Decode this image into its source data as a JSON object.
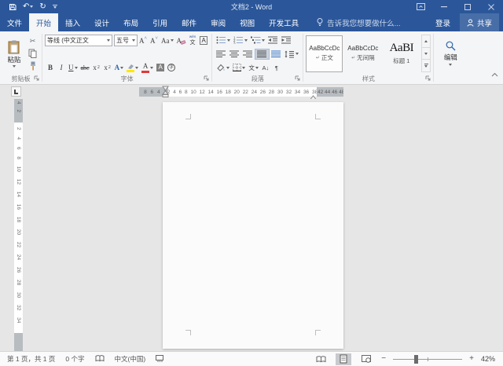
{
  "window": {
    "title": "文档2 - Word"
  },
  "tabs": {
    "file": "文件",
    "home": "开始",
    "insert": "插入",
    "design": "设计",
    "layout": "布局",
    "references": "引用",
    "mailings": "邮件",
    "review": "审阅",
    "view": "视图",
    "developer": "开发工具"
  },
  "tellme": "告诉我您想要做什么...",
  "account": {
    "sign_in": "登录",
    "share": "共享"
  },
  "glyphs": {
    "scissors": "✂",
    "undo": "↶",
    "redo": "↻",
    "sort": "A↓",
    "show_marks": "¶",
    "asian_layout": "文"
  },
  "ribbon": {
    "clipboard": {
      "label": "剪贴板",
      "paste": "粘贴"
    },
    "font": {
      "label": "字体",
      "font_name": "等线 (中文正文",
      "font_size": "五号",
      "grow_font": "A",
      "shrink_font": "A",
      "change_case": "Aa",
      "clear_format": "A",
      "phonetic_top": "wén",
      "phonetic_bottom": "文",
      "char_border": "A",
      "bold": "B",
      "italic": "I",
      "underline": "U",
      "strikethrough": "abc",
      "sub_base": "x",
      "sub_small": "2",
      "sup_base": "x",
      "sup_small": "2",
      "text_effects": "A",
      "font_color": "A",
      "char_shading": "A",
      "enclose": "字"
    },
    "paragraph": {
      "label": "段落"
    },
    "styles": {
      "label": "样式",
      "items": [
        {
          "preview": "AaBbCcDc",
          "mark": "↵",
          "name": "正文"
        },
        {
          "preview": "AaBbCcDc",
          "mark": "↵",
          "name": "无间隔"
        },
        {
          "preview": "AaBI",
          "mark": "",
          "name": "标题 1"
        }
      ]
    },
    "editing": {
      "label": "编辑"
    }
  },
  "ruler": {
    "h_left": "8 6 4 2",
    "h_mid": "2 4 6 8 10 12 14 16 18 20 22 24 26 28 30 32 34 36 38",
    "h_right": "42 44 46 48",
    "v_top": "4 2",
    "v_mid": "2 4 6 8 10 12 14 16 18 20 22 24 26 28 30 32 34"
  },
  "statusbar": {
    "page_info": "第 1 页，共 1 页",
    "word_count": "0 个字",
    "language": "中文(中国)",
    "zoom_minus": "−",
    "zoom_plus": "+",
    "zoom_level": "42%"
  }
}
